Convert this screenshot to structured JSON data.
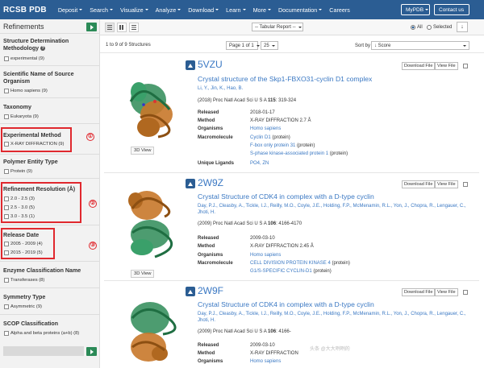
{
  "brand": "RCSB PDB",
  "nav": [
    "Deposit",
    "Search",
    "Visualize",
    "Analyze",
    "Download",
    "Learn",
    "More",
    "Documentation",
    "Careers"
  ],
  "nav_buttons": {
    "mypdb": "MyPDB",
    "contact": "Contact us"
  },
  "sidebar": {
    "title": "Refinements",
    "sections": [
      {
        "title": "Structure Determination Methodology",
        "help": "?",
        "options": [
          "experimental (9)"
        ]
      },
      {
        "title": "Scientific Name of Source Organism",
        "options": [
          "Homo sapiens (9)"
        ]
      },
      {
        "title": "Taxonomy",
        "options": [
          "Eukaryota (9)"
        ]
      },
      {
        "title": "Experimental Method",
        "options": [
          "X-RAY DIFFRACTION (9)"
        ],
        "marker": "①"
      },
      {
        "title": "Polymer Entity Type",
        "options": [
          "Protein (9)"
        ]
      },
      {
        "title": "Refinement Resolution (Å)",
        "options": [
          "2.0 - 2.5 (3)",
          "2.5 - 3.0 (5)",
          "3.0 - 3.5 (1)"
        ],
        "marker": "②"
      },
      {
        "title": "Release Date",
        "options": [
          "2005 - 2009 (4)",
          "2015 - 2019 (5)"
        ],
        "marker": "③"
      },
      {
        "title": "Enzyme Classification Name",
        "options": [
          "Transferases (8)"
        ]
      },
      {
        "title": "Symmetry Type",
        "options": [
          "Asymmetric (9)"
        ]
      },
      {
        "title": "SCOP Classification",
        "options": [
          "Alpha and beta proteins (a+b) (8)"
        ]
      }
    ]
  },
  "toolbar": {
    "report": "-- Tabular Report --",
    "radio_all": "All",
    "radio_selected": "Selected",
    "download_icon": "↓"
  },
  "results": {
    "count_text": "1 to 9 of 9 Structures",
    "page": "Page 1 of 1",
    "per_page": "25",
    "sort_label": "Sort by",
    "sort_value": "↓ Score"
  },
  "entry_buttons": {
    "download": "Download File",
    "view": "View File"
  },
  "view3d": "3D View",
  "entries": [
    {
      "id": "5VZU",
      "title": "Crystal structure of the Skp1-FBXO31-cyclin D1 complex",
      "authors": "Li, Y., Jin, K., Hao, B.",
      "citation_pre": "(2018) Proc Natl Acad Sci U S A ",
      "citation_vol": "115",
      "citation_post": ": 319-324",
      "released_label": "Released",
      "released": "2018-01-17",
      "method_label": "Method",
      "method": "X-RAY DIFFRACTION 2.7 Å",
      "organisms_label": "Organisms",
      "organisms": "Homo sapiens",
      "macro_label": "Macromolecule",
      "macro": [
        {
          "name": "Cyclin D1",
          "suffix": " (protein)"
        },
        {
          "name": "F-box only protein 31",
          "suffix": " (protein)"
        },
        {
          "name": "S-phase kinase-associated protein 1",
          "suffix": " (protein)"
        }
      ],
      "ligands_label": "Unique Ligands",
      "ligands": "PO4, ZN"
    },
    {
      "id": "2W9Z",
      "title": "Crystal Structure of CDK4 in complex with a D-type cyclin",
      "authors": "Day, P.J., Cleasby, A., Tickle, I.J., Reilly, M.O., Coyle, J.E., Holding, F.P., McMenamin, R.L., Yon, J., Chopra, R., Lengauer, C., Jhoti, H.",
      "citation_pre": "(2009) Proc Natl Acad Sci U S A ",
      "citation_vol": "106",
      "citation_post": ": 4166-4170",
      "released_label": "Released",
      "released": "2009-03-10",
      "method_label": "Method",
      "method": "X-RAY DIFFRACTION 2.45 Å",
      "organisms_label": "Organisms",
      "organisms": "Homo sapiens",
      "macro_label": "Macromolecule",
      "macro": [
        {
          "name": "CELL DIVISION PROTEIN KINASE 4",
          "suffix": " (protein)"
        },
        {
          "name": "G1/S-SPECIFIC CYCLIN-D1",
          "suffix": " (protein)"
        }
      ]
    },
    {
      "id": "2W9F",
      "title": "Crystal Structure of CDK4 in complex with a D-type cyclin",
      "authors": "Day, P.J., Cleasby, A., Tickle, I.J., Reilly, M.O., Coyle, J.E., Holding, F.P., McMenamin, R.L., Yon, J., Chopra, R., Lengauer, C., Jhoti, H.",
      "citation_pre": "(2009) Proc Natl Acad Sci U S A ",
      "citation_vol": "106",
      "citation_post": ": 4166-",
      "released_label": "Released",
      "released": "2009-03-10",
      "method_label": "Method",
      "method": "X-RAY DIFFRACTION",
      "organisms_label": "Organisms",
      "organisms": "Homo sapiens"
    }
  ],
  "colors": {
    "nav": "#2b5d93",
    "link": "#3a78c3",
    "accent_green": "#2b8a57",
    "highlight_red": "#e0282e",
    "protein_orange": "#c8782a",
    "protein_green": "#2e8b57"
  },
  "watermark": "头条 @大大咧咧的"
}
